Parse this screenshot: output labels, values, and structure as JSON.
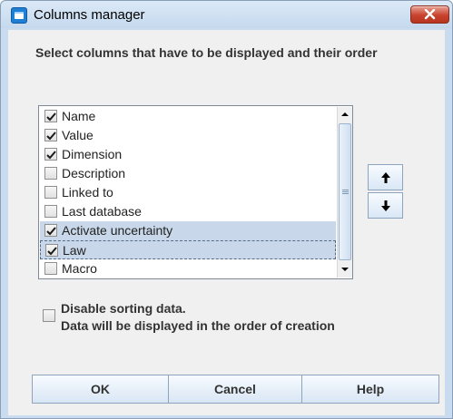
{
  "window": {
    "title": "Columns manager",
    "app_icon": "app-window-icon",
    "close_icon": "close-icon"
  },
  "heading": "Select columns that have to be displayed and their order",
  "columns": [
    {
      "label": "Name",
      "checked": true,
      "state": "normal"
    },
    {
      "label": "Value",
      "checked": true,
      "state": "normal"
    },
    {
      "label": "Dimension",
      "checked": true,
      "state": "normal"
    },
    {
      "label": "Description",
      "checked": false,
      "state": "normal"
    },
    {
      "label": "Linked to",
      "checked": false,
      "state": "normal"
    },
    {
      "label": "Last database",
      "checked": false,
      "state": "normal"
    },
    {
      "label": "Activate uncertainty",
      "checked": true,
      "state": "selected"
    },
    {
      "label": "Law",
      "checked": true,
      "state": "focused"
    },
    {
      "label": "Macro",
      "checked": false,
      "state": "normal"
    }
  ],
  "order_buttons": {
    "up_icon": "arrow-up-icon",
    "down_icon": "arrow-down-icon"
  },
  "sorting_option": {
    "checked": false,
    "line1": "Disable sorting data.",
    "line2": "Data will be displayed in the order of creation"
  },
  "buttons": {
    "ok": "OK",
    "cancel": "Cancel",
    "help": "Help"
  },
  "colors": {
    "frame": "#c9dcef",
    "selection": "#c8d8ea",
    "close": "#c7432e"
  }
}
